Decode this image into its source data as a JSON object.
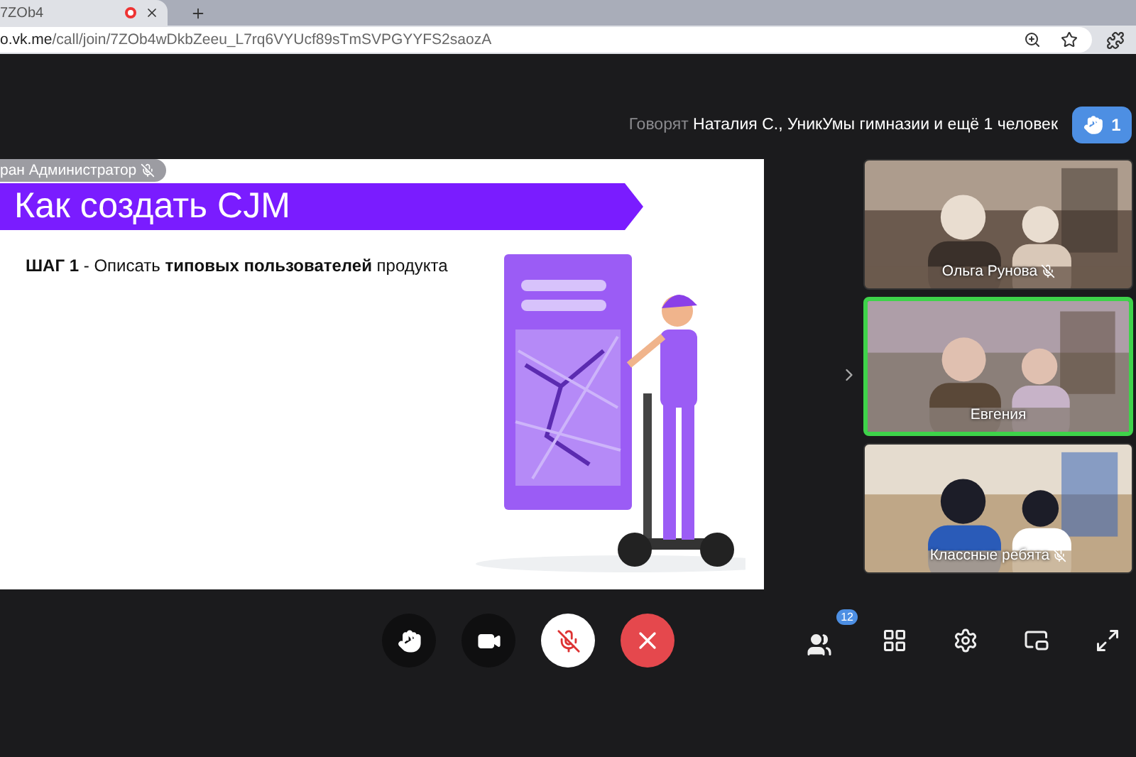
{
  "browser": {
    "tab_title": "7ZOb4",
    "recording": true,
    "url_host": "o.vk.me",
    "url_path": "/call/join/7ZOb4wDkbZeeu_L7rq6VYUcf89sTmSVPGYYFS2saozA"
  },
  "header": {
    "speaking_label": "Говорят",
    "speakers": "Наталия С., УникУмы гимназии и ещё 1 человек",
    "raised_hands": "1"
  },
  "slide": {
    "presenter": "ран Администратор",
    "presenter_muted": true,
    "title": "Как создать CJM",
    "step": "**ШАГ 1** - Описать **типовых пользователей** продукта"
  },
  "participants": [
    {
      "name": "Ольга Рунова",
      "muted": true,
      "speaking": false
    },
    {
      "name": "Евгения",
      "muted": false,
      "speaking": true
    },
    {
      "name": "Классные ребята",
      "muted": true,
      "speaking": false
    }
  ],
  "controls": {
    "mic_muted": true,
    "participants_count": "12"
  }
}
